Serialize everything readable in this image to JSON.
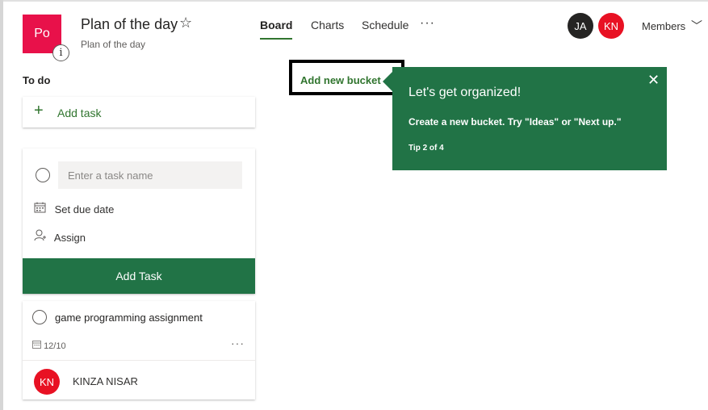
{
  "header": {
    "plan_logo_text": "Po",
    "info_glyph": "i",
    "title": "Plan of the day",
    "subtitle": "Plan of the day",
    "star_glyph": "☆",
    "tabs": [
      {
        "label": "Board",
        "active": true
      },
      {
        "label": "Charts",
        "active": false
      },
      {
        "label": "Schedule",
        "active": false
      }
    ],
    "more_glyph": "···",
    "members": [
      {
        "initials": "JA",
        "color": "#252423"
      },
      {
        "initials": "KN",
        "color": "#e81123"
      }
    ],
    "members_label": "Members",
    "chevron_glyph": "﹀"
  },
  "bucket": {
    "title": "To do",
    "add_task_label": "Add task",
    "new_task": {
      "placeholder": "Enter a task name",
      "due_date_label": "Set due date",
      "assign_label": "Assign",
      "submit_label": "Add Task"
    },
    "tasks": [
      {
        "title": "game programming assignment",
        "due": "12/10",
        "assignee_initials": "KN",
        "assignee_name": "KINZA NISAR"
      }
    ]
  },
  "add_bucket_label": "Add new bucket",
  "tip": {
    "title": "Let's get organized!",
    "body": "Create a new bucket. Try \"Ideas\" or \"Next up.\"",
    "step": "Tip 2 of 4",
    "close_glyph": "✕"
  },
  "colors": {
    "accent": "#217346",
    "link": "#31752f",
    "plan_logo": "#e8114a",
    "member_red": "#e81123"
  },
  "icons": {
    "info": "info-icon",
    "star": "star-icon",
    "more": "more-icon",
    "chevron": "chevron-down-icon",
    "plus": "plus-icon",
    "calendar": "calendar-icon",
    "person": "person-icon",
    "close": "close-icon"
  }
}
